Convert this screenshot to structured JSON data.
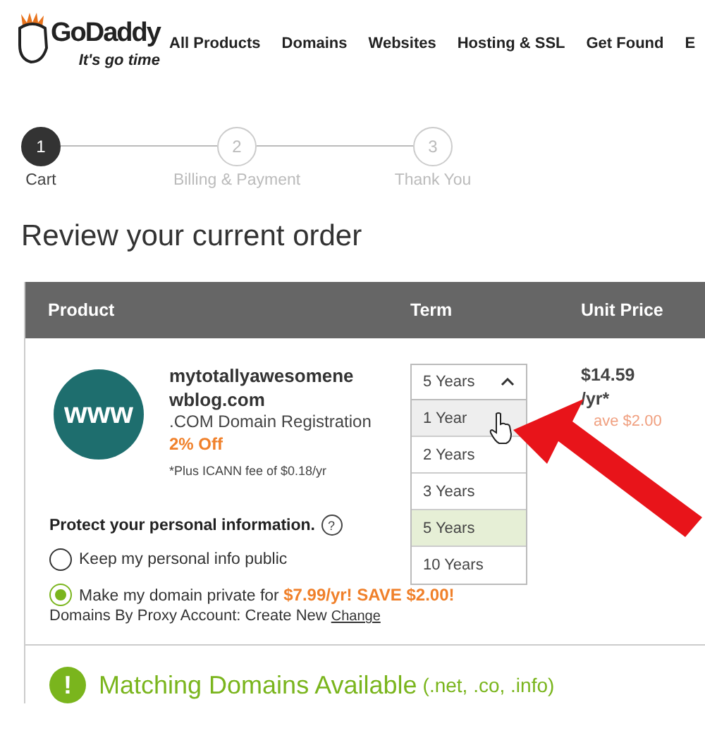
{
  "logo": {
    "brand": "GoDaddy",
    "tagline": "It's go time"
  },
  "nav": [
    "All Products",
    "Domains",
    "Websites",
    "Hosting & SSL",
    "Get Found",
    "E"
  ],
  "steps": [
    {
      "number": "1",
      "label": "Cart",
      "selected": true
    },
    {
      "number": "2",
      "label": "Billing & Payment",
      "selected": false
    },
    {
      "number": "3",
      "label": "Thank You",
      "selected": false
    }
  ],
  "title": "Review your current order",
  "table": {
    "columns": [
      "Product",
      "Term",
      "Unit Price"
    ],
    "item": {
      "icon_text": "www",
      "name": "mytotallyawesomenewblog.com",
      "description": ".COM Domain Registration",
      "discount": "2% Off",
      "fee_note": "*Plus ICANN fee of $0.18/yr",
      "term": {
        "value": "5 Years",
        "expanded": true,
        "options": [
          {
            "label": "1 Year",
            "selected": false,
            "hovered": true
          },
          {
            "label": "2 Years",
            "selected": false,
            "hovered": false
          },
          {
            "label": "3 Years",
            "selected": false,
            "hovered": false
          },
          {
            "label": "5 Years",
            "selected": true,
            "hovered": false
          },
          {
            "label": "10 Years",
            "selected": false,
            "hovered": false
          }
        ]
      },
      "price": "$14.59 /yr*",
      "savings": "ave $2.00"
    }
  },
  "privacy": {
    "heading": "Protect your personal information.",
    "help": "?",
    "options": [
      {
        "label": "Keep my personal info public",
        "selected": false
      },
      {
        "label": "Make my domain private for **$7.99/yr! SAVE $2.00!**",
        "selected": true
      }
    ],
    "account": "Domains By Proxy Account: Create New",
    "link": "Change"
  },
  "matching": {
    "alert": "!",
    "heading": "Matching Domains Available",
    "extensions": "(.net, .co, .info)"
  }
}
